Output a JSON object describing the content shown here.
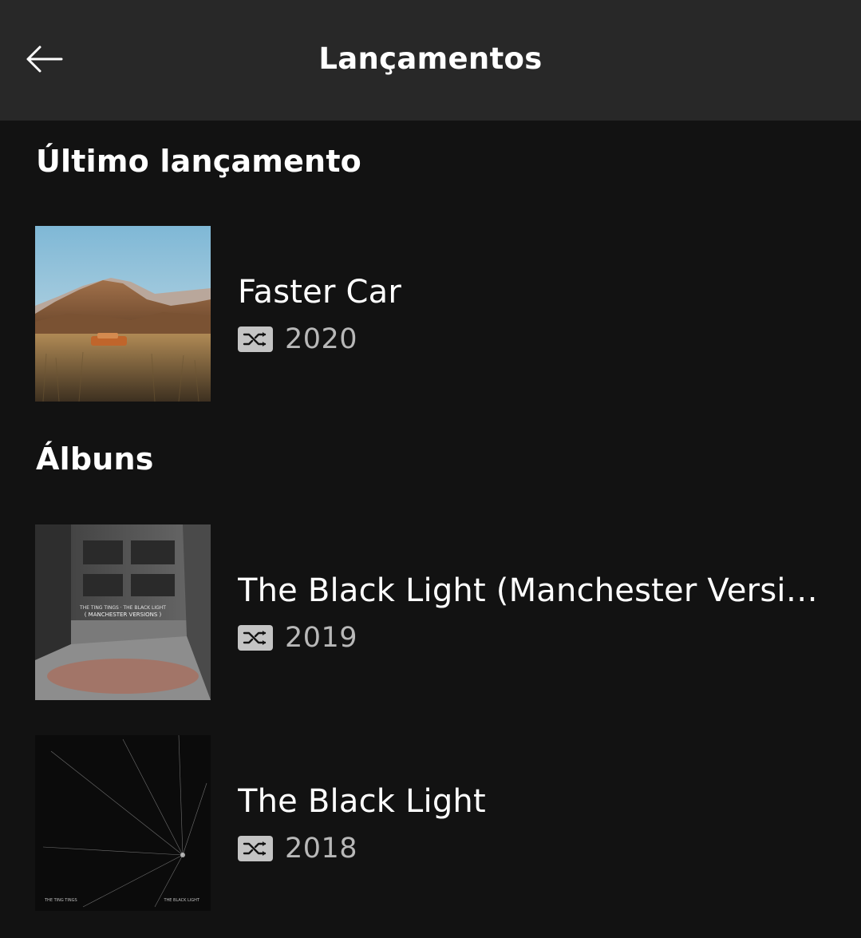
{
  "header": {
    "title": "Lançamentos",
    "back_icon": "arrow-left-icon"
  },
  "sections": [
    {
      "title": "Último lançamento",
      "items": [
        {
          "name": "Faster Car",
          "year": "2020",
          "badge_icon": "shuffle-icon"
        }
      ]
    },
    {
      "title": "Álbuns",
      "items": [
        {
          "name": "The Black Light (Manchester Versions)",
          "year": "2019",
          "badge_icon": "shuffle-icon",
          "cover_text": [
            "THE TING TINGS · THE BLACK LIGHT",
            "( MANCHESTER VERSIONS )"
          ]
        },
        {
          "name": "The Black Light",
          "year": "2018",
          "badge_icon": "shuffle-icon",
          "cover_text": [
            "THE TING TINGS",
            "THE BLACK LIGHT"
          ]
        }
      ]
    }
  ],
  "colors": {
    "background": "#121212",
    "header_background": "#282828",
    "text_primary": "#ffffff",
    "text_secondary": "#b8b8b8",
    "badge": "#c4c4c4"
  }
}
